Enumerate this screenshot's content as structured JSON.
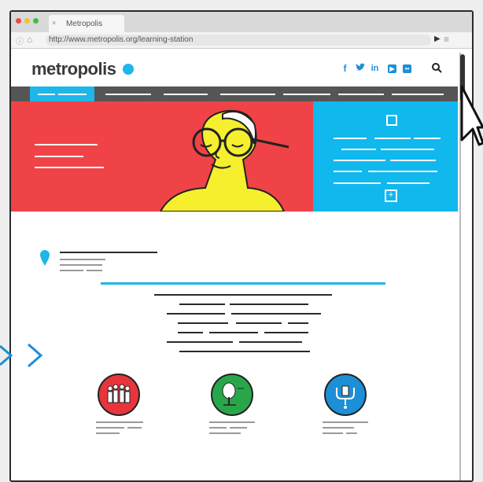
{
  "browser": {
    "tab_title": "Metropolis",
    "tab_close": "×",
    "url": "http://www.metropolis.org/learning-station"
  },
  "site": {
    "logo_text": "metropolis",
    "social": [
      "f",
      "t",
      "in",
      "yt",
      "fl"
    ],
    "search_icon": "search-icon"
  },
  "colors": {
    "brand_blue": "#1fb6e8",
    "hero_red": "#ef4347",
    "figure_yellow": "#f5ef2e",
    "icon_red": "#e8353c",
    "icon_green": "#28a64a",
    "icon_blue": "#1c8fd6"
  },
  "icons": [
    "location-pin-icon",
    "people-icon",
    "tree-icon",
    "water-tap-icon",
    "chevron-right-icon",
    "cursor-icon"
  ]
}
